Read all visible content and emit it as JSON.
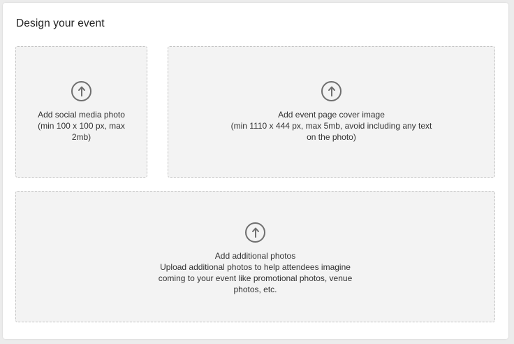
{
  "section": {
    "title": "Design your event"
  },
  "dropzones": {
    "social": {
      "icon": "upload-arrow-icon",
      "title": "Add social media photo",
      "hint": "(min 100 x 100 px, max 2mb)"
    },
    "cover": {
      "icon": "upload-arrow-icon",
      "title": "Add event page cover image",
      "hint": "(min 1110 x 444 px, max 5mb, avoid including any text on the photo)"
    },
    "additional": {
      "icon": "upload-arrow-icon",
      "title": "Add additional photos",
      "hint": "Upload additional photos to help attendees imagine coming to your event like promotional photos, venue photos, etc."
    }
  },
  "colors": {
    "dropzone_bg": "#f3f3f3",
    "dropzone_border": "#c4c4c4",
    "icon": "#6f6f6f"
  }
}
